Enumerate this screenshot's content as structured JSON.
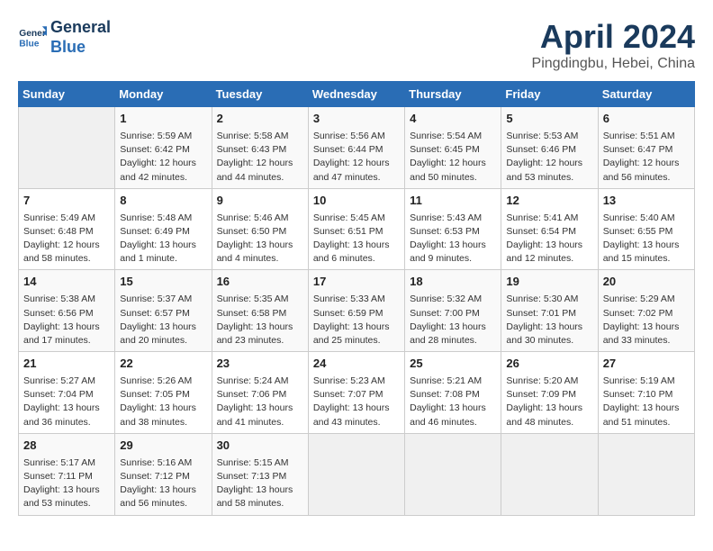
{
  "header": {
    "logo_line1": "General",
    "logo_line2": "Blue",
    "title": "April 2024",
    "subtitle": "Pingdingbu, Hebei, China"
  },
  "weekdays": [
    "Sunday",
    "Monday",
    "Tuesday",
    "Wednesday",
    "Thursday",
    "Friday",
    "Saturday"
  ],
  "weeks": [
    [
      {
        "day": "",
        "content": ""
      },
      {
        "day": "1",
        "content": "Sunrise: 5:59 AM\nSunset: 6:42 PM\nDaylight: 12 hours\nand 42 minutes."
      },
      {
        "day": "2",
        "content": "Sunrise: 5:58 AM\nSunset: 6:43 PM\nDaylight: 12 hours\nand 44 minutes."
      },
      {
        "day": "3",
        "content": "Sunrise: 5:56 AM\nSunset: 6:44 PM\nDaylight: 12 hours\nand 47 minutes."
      },
      {
        "day": "4",
        "content": "Sunrise: 5:54 AM\nSunset: 6:45 PM\nDaylight: 12 hours\nand 50 minutes."
      },
      {
        "day": "5",
        "content": "Sunrise: 5:53 AM\nSunset: 6:46 PM\nDaylight: 12 hours\nand 53 minutes."
      },
      {
        "day": "6",
        "content": "Sunrise: 5:51 AM\nSunset: 6:47 PM\nDaylight: 12 hours\nand 56 minutes."
      }
    ],
    [
      {
        "day": "7",
        "content": "Sunrise: 5:49 AM\nSunset: 6:48 PM\nDaylight: 12 hours\nand 58 minutes."
      },
      {
        "day": "8",
        "content": "Sunrise: 5:48 AM\nSunset: 6:49 PM\nDaylight: 13 hours\nand 1 minute."
      },
      {
        "day": "9",
        "content": "Sunrise: 5:46 AM\nSunset: 6:50 PM\nDaylight: 13 hours\nand 4 minutes."
      },
      {
        "day": "10",
        "content": "Sunrise: 5:45 AM\nSunset: 6:51 PM\nDaylight: 13 hours\nand 6 minutes."
      },
      {
        "day": "11",
        "content": "Sunrise: 5:43 AM\nSunset: 6:53 PM\nDaylight: 13 hours\nand 9 minutes."
      },
      {
        "day": "12",
        "content": "Sunrise: 5:41 AM\nSunset: 6:54 PM\nDaylight: 13 hours\nand 12 minutes."
      },
      {
        "day": "13",
        "content": "Sunrise: 5:40 AM\nSunset: 6:55 PM\nDaylight: 13 hours\nand 15 minutes."
      }
    ],
    [
      {
        "day": "14",
        "content": "Sunrise: 5:38 AM\nSunset: 6:56 PM\nDaylight: 13 hours\nand 17 minutes."
      },
      {
        "day": "15",
        "content": "Sunrise: 5:37 AM\nSunset: 6:57 PM\nDaylight: 13 hours\nand 20 minutes."
      },
      {
        "day": "16",
        "content": "Sunrise: 5:35 AM\nSunset: 6:58 PM\nDaylight: 13 hours\nand 23 minutes."
      },
      {
        "day": "17",
        "content": "Sunrise: 5:33 AM\nSunset: 6:59 PM\nDaylight: 13 hours\nand 25 minutes."
      },
      {
        "day": "18",
        "content": "Sunrise: 5:32 AM\nSunset: 7:00 PM\nDaylight: 13 hours\nand 28 minutes."
      },
      {
        "day": "19",
        "content": "Sunrise: 5:30 AM\nSunset: 7:01 PM\nDaylight: 13 hours\nand 30 minutes."
      },
      {
        "day": "20",
        "content": "Sunrise: 5:29 AM\nSunset: 7:02 PM\nDaylight: 13 hours\nand 33 minutes."
      }
    ],
    [
      {
        "day": "21",
        "content": "Sunrise: 5:27 AM\nSunset: 7:04 PM\nDaylight: 13 hours\nand 36 minutes."
      },
      {
        "day": "22",
        "content": "Sunrise: 5:26 AM\nSunset: 7:05 PM\nDaylight: 13 hours\nand 38 minutes."
      },
      {
        "day": "23",
        "content": "Sunrise: 5:24 AM\nSunset: 7:06 PM\nDaylight: 13 hours\nand 41 minutes."
      },
      {
        "day": "24",
        "content": "Sunrise: 5:23 AM\nSunset: 7:07 PM\nDaylight: 13 hours\nand 43 minutes."
      },
      {
        "day": "25",
        "content": "Sunrise: 5:21 AM\nSunset: 7:08 PM\nDaylight: 13 hours\nand 46 minutes."
      },
      {
        "day": "26",
        "content": "Sunrise: 5:20 AM\nSunset: 7:09 PM\nDaylight: 13 hours\nand 48 minutes."
      },
      {
        "day": "27",
        "content": "Sunrise: 5:19 AM\nSunset: 7:10 PM\nDaylight: 13 hours\nand 51 minutes."
      }
    ],
    [
      {
        "day": "28",
        "content": "Sunrise: 5:17 AM\nSunset: 7:11 PM\nDaylight: 13 hours\nand 53 minutes."
      },
      {
        "day": "29",
        "content": "Sunrise: 5:16 AM\nSunset: 7:12 PM\nDaylight: 13 hours\nand 56 minutes."
      },
      {
        "day": "30",
        "content": "Sunrise: 5:15 AM\nSunset: 7:13 PM\nDaylight: 13 hours\nand 58 minutes."
      },
      {
        "day": "",
        "content": ""
      },
      {
        "day": "",
        "content": ""
      },
      {
        "day": "",
        "content": ""
      },
      {
        "day": "",
        "content": ""
      }
    ]
  ]
}
